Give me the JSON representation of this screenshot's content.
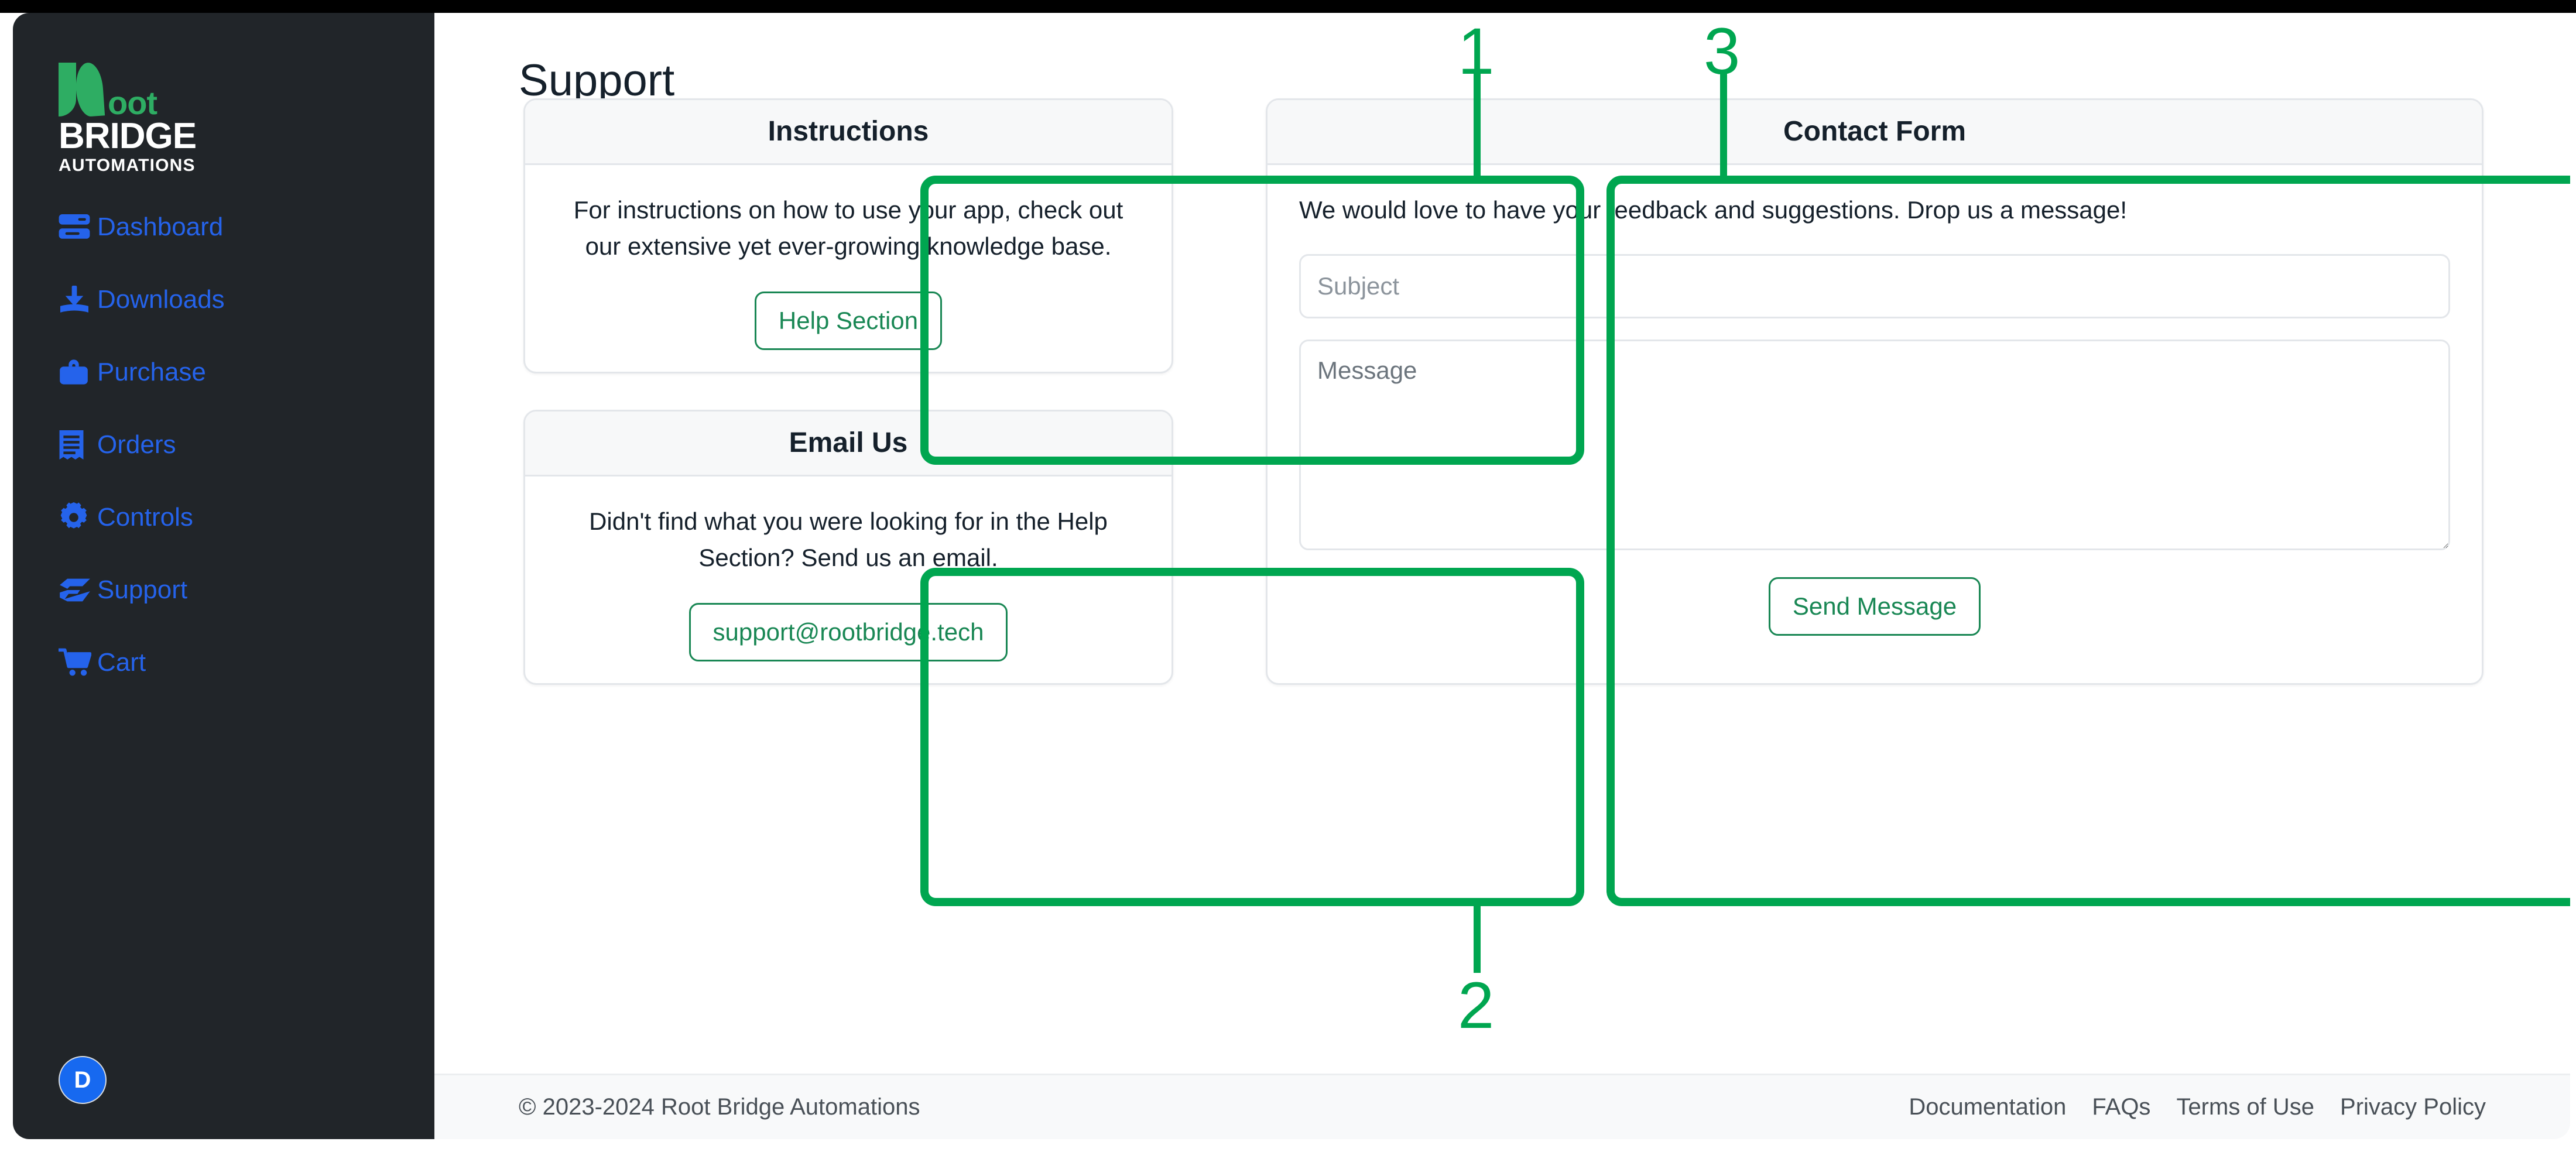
{
  "app": {
    "brand": {
      "mark_label": "R",
      "word_top": "oot",
      "word_mid": "BRIDGE",
      "word_bot": "AUTOMATIONS"
    },
    "accent_green": "#00A650",
    "button_green": "#198754",
    "link_blue": "#2563eb",
    "sidebar_bg": "#212529"
  },
  "sidebar": {
    "items": [
      {
        "label": "Dashboard",
        "icon": "server-stack-icon"
      },
      {
        "label": "Downloads",
        "icon": "download-icon"
      },
      {
        "label": "Purchase",
        "icon": "briefcase-icon"
      },
      {
        "label": "Orders",
        "icon": "receipt-icon"
      },
      {
        "label": "Controls",
        "icon": "gear-icon"
      },
      {
        "label": "Support",
        "icon": "hands-helping-icon"
      },
      {
        "label": "Cart",
        "icon": "shopping-cart-icon"
      }
    ],
    "avatar": {
      "initial": "D"
    }
  },
  "page": {
    "title": "Support"
  },
  "cards": {
    "instructions": {
      "title": "Instructions",
      "body": "For instructions on how to use your app, check out our extensive yet ever-growing knowledge base.",
      "button": "Help Section"
    },
    "email": {
      "title": "Email Us",
      "body": "Didn't find what you were looking for in the Help Section? Send us an email.",
      "button": "support@rootbridge.tech"
    },
    "contact": {
      "title": "Contact Form",
      "body": "We would love to have your feedback and suggestions. Drop us a message!",
      "subject_placeholder": "Subject",
      "subject_value": "",
      "message_placeholder": "Message",
      "message_value": "",
      "submit": "Send Message"
    }
  },
  "footer": {
    "copyright": "© 2023-2024 Root Bridge Automations",
    "links": [
      {
        "label": "Documentation"
      },
      {
        "label": "FAQs"
      },
      {
        "label": "Terms of Use"
      },
      {
        "label": "Privacy Policy"
      }
    ]
  },
  "annotations": {
    "markers": [
      {
        "number": "1",
        "target": "instructions-card"
      },
      {
        "number": "2",
        "target": "email-us-card"
      },
      {
        "number": "3",
        "target": "contact-form-card"
      }
    ]
  }
}
